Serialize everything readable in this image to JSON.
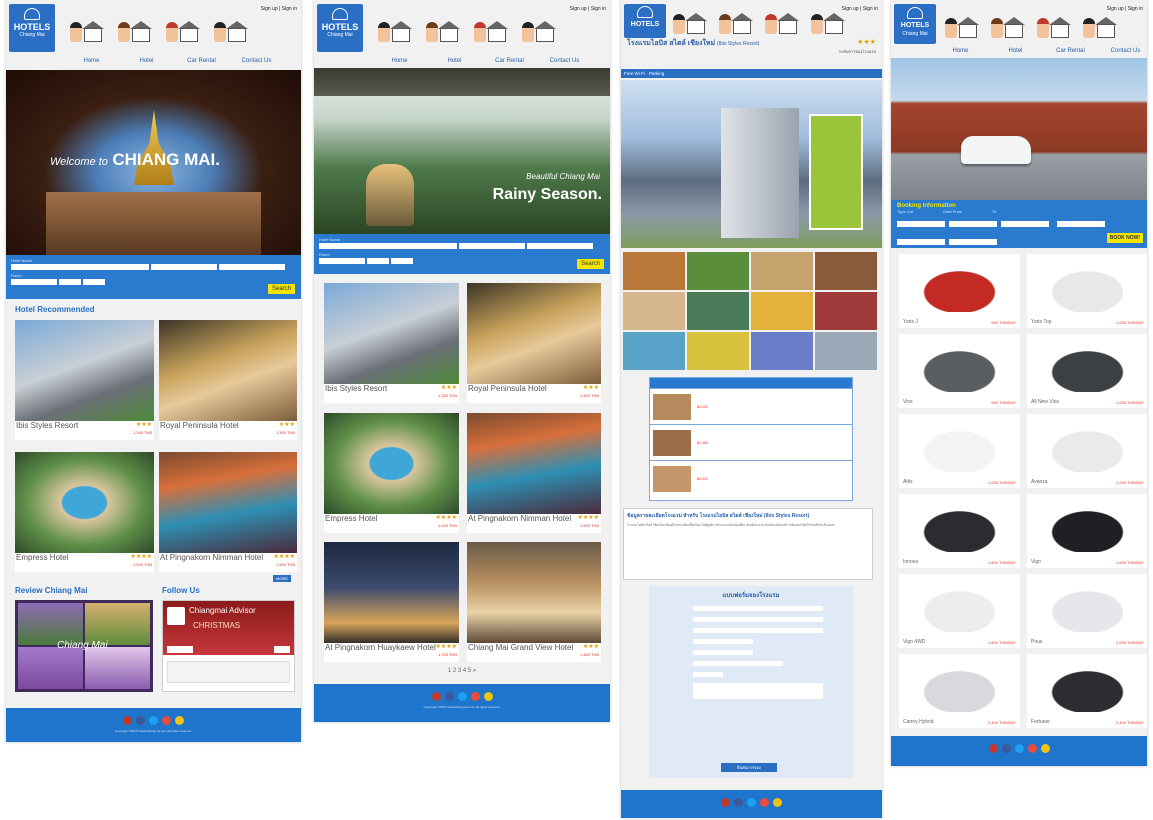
{
  "brand": {
    "line1": "HOTELS",
    "line2": "Chiang Mai"
  },
  "header": {
    "signin": "Sign up | Sign in"
  },
  "nav": [
    "Home",
    "Hotel",
    "Car Rental",
    "Contact Us"
  ],
  "page1": {
    "hero_welcome": "Welcome to",
    "hero_city": "CHIANG MAI.",
    "search_labels": [
      "Hotel Name",
      "Check in",
      "Check out",
      "Room",
      "Child",
      "Adult"
    ],
    "search_button": "Search",
    "section_recommended": "Hotel Recommended",
    "hotels": [
      {
        "name": "Ibis Styles Resort",
        "stars": "★★★",
        "price": "1,260 THB"
      },
      {
        "name": "Royal Peninsula Hotel",
        "stars": "★★★",
        "price": "1,300 THB"
      },
      {
        "name": "Empress Hotel",
        "stars": "★★★★",
        "price": "1,540 THB"
      },
      {
        "name": "At Pingnakorn Nimman Hotel",
        "stars": "★★★★",
        "price": "1,500 THB"
      }
    ],
    "more_button": "MORE",
    "section_review": "Review Chiang Mai",
    "review_caption": "Chiang Mai",
    "section_follow": "Follow Us",
    "follow_title": "Chiangmai Advisor",
    "follow_banner": "CHRISTMAS"
  },
  "page2": {
    "hero_line1": "Beautiful Chiang Mai",
    "hero_line2": "Rainy Season.",
    "search_labels": [
      "Hotel Name",
      "Check in",
      "Check out",
      "Room",
      "Child",
      "Adult"
    ],
    "search_button": "Search",
    "hotels": [
      {
        "name": "Ibis Styles Resort",
        "stars": "★★★",
        "price": "1,260 THB"
      },
      {
        "name": "Royal Peninsula Hotel",
        "stars": "★★★",
        "price": "1,300 THB"
      },
      {
        "name": "Empress Hotel",
        "stars": "★★★★",
        "price": "1,540 THB"
      },
      {
        "name": "At Pingnakorn Nimman Hotel",
        "stars": "★★★★",
        "price": "1,500 THB"
      },
      {
        "name": "At Pingnakorn Huaykaew Hotel",
        "stars": "★★★★",
        "price": "1,750 THB"
      },
      {
        "name": "Chiang Mai Grand View Hotel",
        "stars": "★★★",
        "price": "1,460 THB"
      }
    ],
    "pager": "1 2 3 4 5 »"
  },
  "page3": {
    "hotel_title": "โรงแรมไอบิส สไตล์ เชียงใหม่",
    "hotel_title_en": "(Ibis Styles Resort)",
    "stars": "★★★",
    "rating_note": "ระดับดาวของโรงแรม",
    "features_bar": "Free Wi-Fi   ·   Parking",
    "detail_heading": "ข้อมูลรายละเอียดโรงแรม สำหรับ โรงแรมไอบิส สไตล์ เชียงใหม่ (Ibis Styles Resort)",
    "detail_body": "โรงแรมไอบิส สไตล์ เชียงใหม่ ตั้งอยู่ใจกลางเมืองเชียงใหม่ ใกล้ศูนย์การค้าและแหล่งท่องเที่ยว ห้องพักสะอาด ทันสมัย พร้อมบริการอินเทอร์เน็ตไร้สายฟรีและที่จอดรถ",
    "room_rates": [
      "฿1,260",
      "฿1,480",
      "฿1,900"
    ],
    "form_heading": "แบบฟอร์มจองโรงแรม",
    "form_button": "ยืนยันการจอง"
  },
  "page4": {
    "booking_heading": "Booking Information",
    "booking_labels": [
      "Type Car",
      "Date From",
      "To",
      "Name",
      "Phone",
      "E-mail"
    ],
    "book_button": "BOOK NOW!",
    "cars": [
      {
        "name": "Yaris J",
        "price": "900 THB/DAY",
        "color": "#c42a24"
      },
      {
        "name": "Yaris Top",
        "price": "1,000 THB/DAY",
        "color": "#e6e8ea"
      },
      {
        "name": "Vios",
        "price": "900 THB/DAY",
        "color": "#5a5d62"
      },
      {
        "name": "All New Vios",
        "price": "1,000 THB/DAY",
        "color": "#3c3f44"
      },
      {
        "name": "Altis",
        "price": "1,000 THB/DAY",
        "color": "#f2f3f5"
      },
      {
        "name": "Avanza",
        "price": "1,200 THB/DAY",
        "color": "#e9eaec"
      },
      {
        "name": "Innova",
        "price": "1,800 THB/DAY",
        "color": "#2a2c30"
      },
      {
        "name": "Vigo",
        "price": "1,600 THB/DAY",
        "color": "#1f2023"
      },
      {
        "name": "Vigo 4WD",
        "price": "1,800 THB/DAY",
        "color": "#eceded"
      },
      {
        "name": "Prius",
        "price": "2,000 THB/DAY",
        "color": "#e5e7ea"
      },
      {
        "name": "Camry Hybrid",
        "price": "2,400 THB/DAY",
        "color": "#d7d9dc"
      },
      {
        "name": "Fortuner",
        "price": "2,400 THB/DAY",
        "color": "#2b2d31"
      }
    ]
  },
  "footer": {
    "copyright": "Copyright ©2015 hotelschiangmai.com All rights reserved."
  },
  "colors": {
    "primary": "#2a6fc4",
    "footer": "#1f74cb",
    "accent": "#f5e400",
    "price": "#e3332b",
    "star": "#e6a100"
  }
}
